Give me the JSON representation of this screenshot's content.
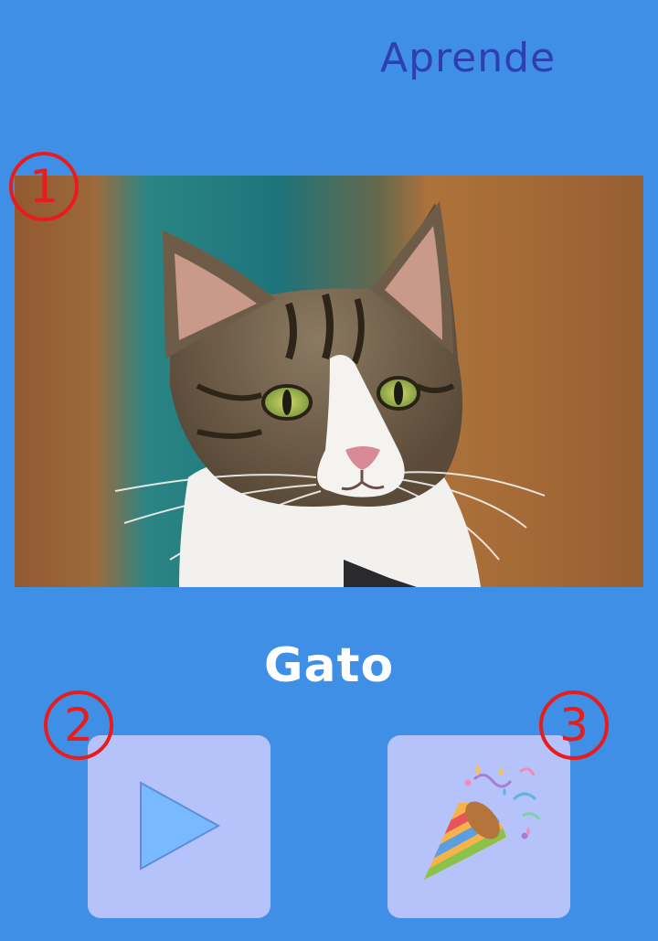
{
  "header": {
    "title": "Aprende"
  },
  "card": {
    "word": "Gato",
    "image_subject": "cat-photo"
  },
  "controls": {
    "play_icon": "play-icon",
    "celebrate_icon": "party-popper-icon"
  },
  "markers": [
    "1",
    "2",
    "3"
  ],
  "colors": {
    "background": "#3f8fe6",
    "title": "#2f3fb0",
    "button_bg": "#b6c3fb",
    "marker": "#e81c1c",
    "play": "#79b9ff"
  }
}
